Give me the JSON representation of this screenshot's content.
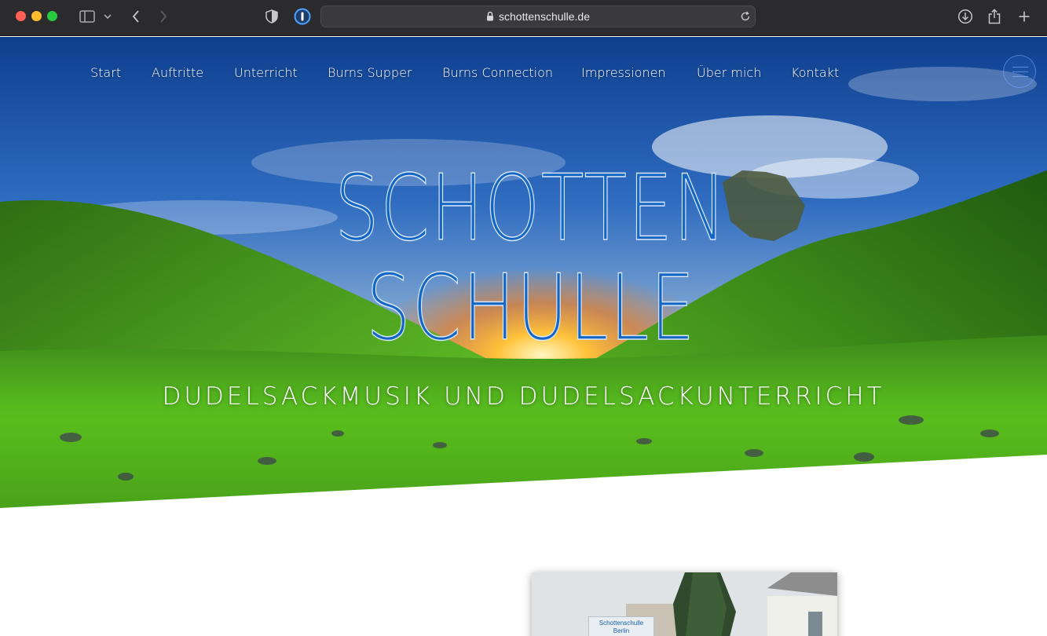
{
  "browser": {
    "url": "schottenschulle.de",
    "icons": [
      "sidebar-icon",
      "chevron-down-icon",
      "back-icon",
      "forward-icon",
      "shield-icon",
      "password-manager-icon",
      "reader-icon",
      "lock-icon",
      "reload-icon",
      "download-icon",
      "share-icon",
      "new-tab-icon"
    ]
  },
  "nav": {
    "items": [
      "Start",
      "Auftritte",
      "Unterricht",
      "Burns Supper",
      "Burns Connection",
      "Impressionen",
      "Über mich",
      "Kontakt"
    ]
  },
  "hero": {
    "logo_line1": "SCHOTTEN",
    "logo_line2": "SCHULLE",
    "tagline": "DUDELSACKMUSIK UND DUDELSACKUNTERRICHT"
  },
  "photo": {
    "sign_line1": "Schottenschulle",
    "sign_line2": "Berlin"
  },
  "colors": {
    "logo_blue": "#1366c4",
    "chrome_bg": "#2b2b2e",
    "sky": "#2a5fb0",
    "grass": "#4fb51e"
  }
}
